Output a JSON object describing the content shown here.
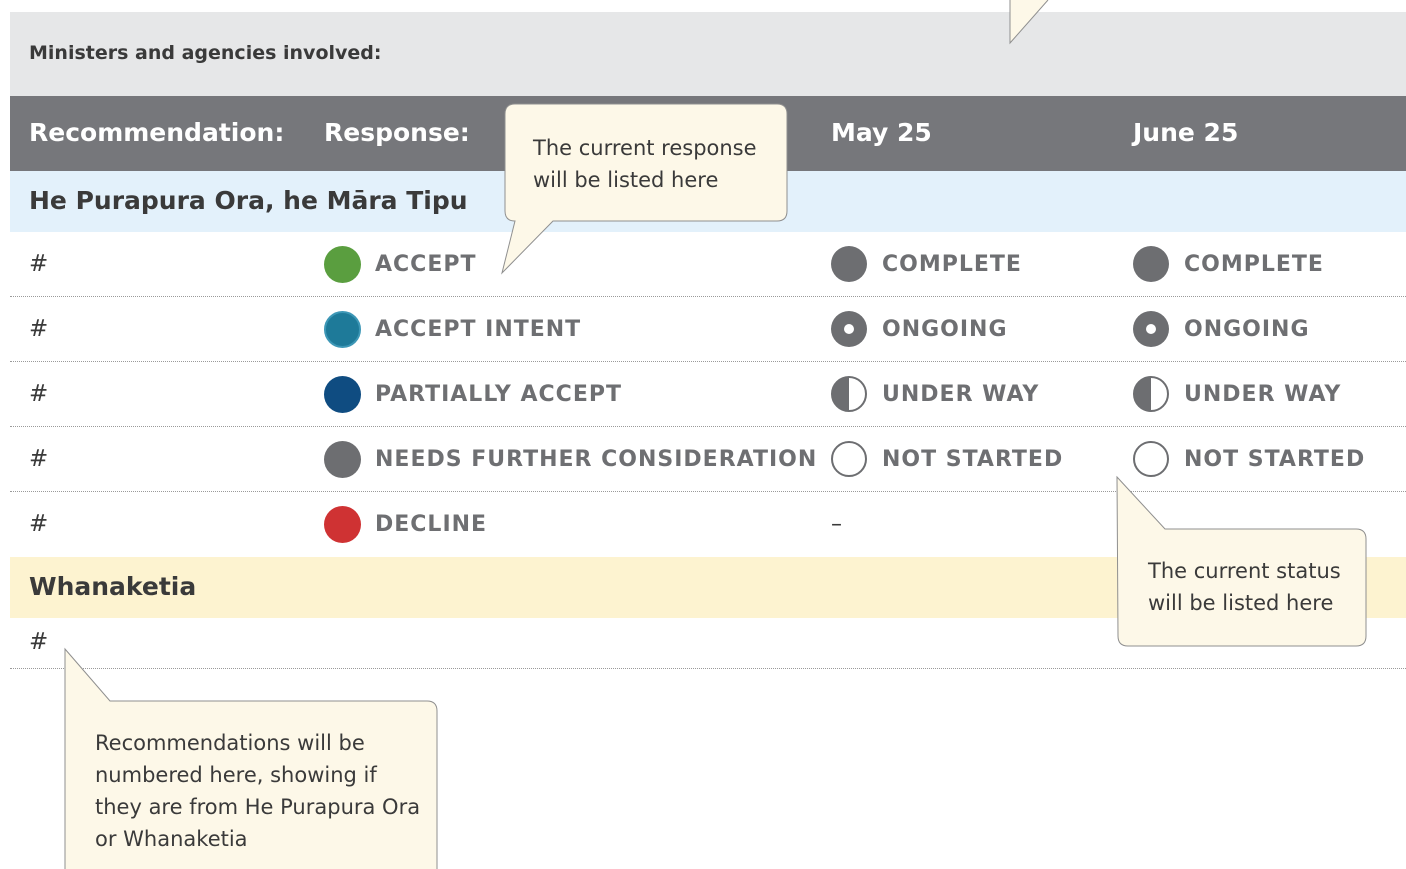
{
  "ministers_label": "Ministers and agencies involved:",
  "header": {
    "recommendation": "Recommendation:",
    "response": "Response:",
    "may": "May 25",
    "june": "June 25"
  },
  "sections": {
    "first": "He Purapura Ora, he Māra Tipu",
    "second": "Whanaketia"
  },
  "rows": [
    {
      "num": "#",
      "response": "ACCEPT",
      "response_color": "#5a9e3f",
      "may": "COMPLETE",
      "june": "COMPLETE"
    },
    {
      "num": "#",
      "response": "ACCEPT INTENT",
      "response_color": "#1e7a99",
      "may": "ONGOING",
      "june": "ONGOING"
    },
    {
      "num": "#",
      "response": "PARTIALLY ACCEPT",
      "response_color": "#0f4c81",
      "may": "UNDER WAY",
      "june": "UNDER WAY"
    },
    {
      "num": "#",
      "response": "NEEDS FURTHER CONSIDERATION",
      "response_color": "#6d6e71",
      "may": "NOT STARTED",
      "june": "NOT STARTED"
    },
    {
      "num": "#",
      "response": "DECLINE",
      "response_color": "#cf3233",
      "may": "–",
      "june": ""
    }
  ],
  "whanaketia_row": {
    "num": "#"
  },
  "callouts": {
    "response": [
      "The current response",
      "will be listed here"
    ],
    "status": [
      "The current status",
      "will be listed here"
    ],
    "numbering": [
      "Recommendations will be",
      "numbered here, showing if",
      "they are from He Purapura Ora",
      "or Whanaketia"
    ]
  },
  "colors": {
    "header_bg": "#76777b",
    "ministers_bg": "#e6e7e8",
    "section_blue_bg": "#e3f1fb",
    "section_yellow_bg": "#fdf3d0",
    "callout_bg": "#fdf8e8",
    "status_grey": "#6d6e71"
  }
}
